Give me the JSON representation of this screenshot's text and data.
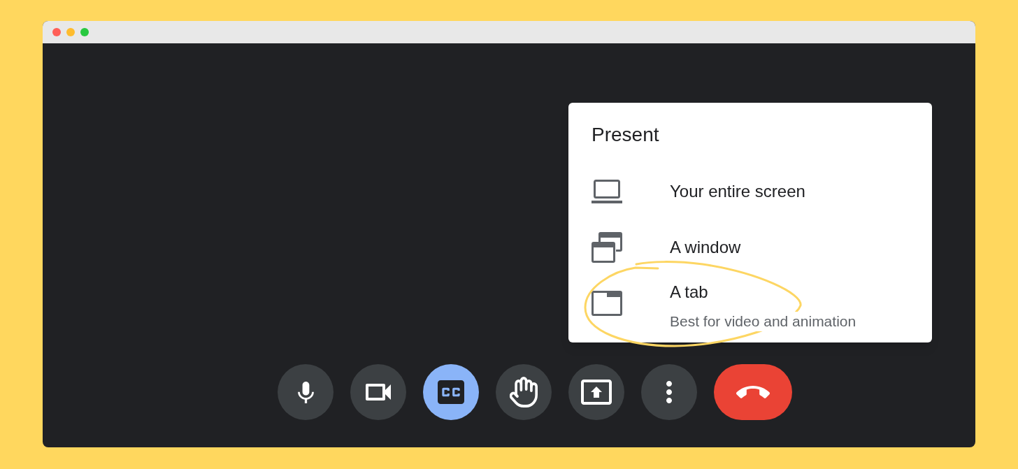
{
  "window": {
    "traffic_lights": [
      {
        "color": "#ff5f57"
      },
      {
        "color": "#febc2e"
      },
      {
        "color": "#28c840"
      }
    ]
  },
  "present_menu": {
    "title": "Present",
    "options": [
      {
        "label": "Your entire screen",
        "circled": false
      },
      {
        "label": "A window",
        "circled": false
      },
      {
        "label": "A tab",
        "description": "Best for video and animation",
        "circled": true
      }
    ]
  },
  "toolbar": {
    "buttons": [
      {
        "kind": "toggle",
        "active": false
      },
      {
        "kind": "toggle",
        "active": false
      },
      {
        "kind": "toggle",
        "active": true
      },
      {
        "kind": "toggle",
        "active": false
      },
      {
        "kind": "toggle",
        "active": false
      },
      {
        "kind": "toggle",
        "active": false
      },
      {
        "kind": "end"
      }
    ]
  }
}
